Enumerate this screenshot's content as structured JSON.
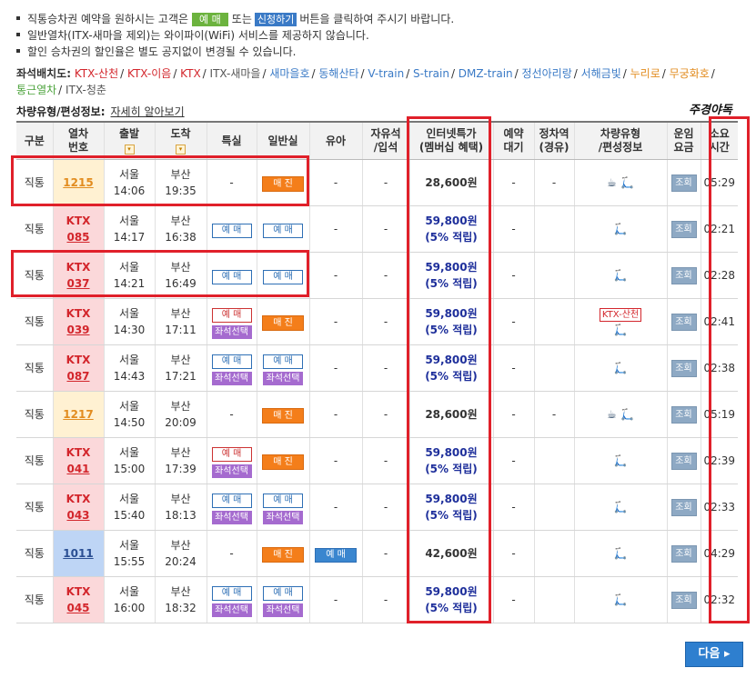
{
  "notes": [
    {
      "pre": "직통승차권 예약을 원하시는 고객은",
      "chip1": "예 매",
      "mid": "또는",
      "chip2": "신청하기",
      "post": "버튼을 클릭하여 주시기 바랍니다."
    },
    {
      "text": "일반열차(ITX-새마을 제외)는 와이파이(WiFi) 서비스를 제공하지 않습니다."
    },
    {
      "text": "할인 승차권의 할인율은 별도 공지없이 변경될 수 있습니다."
    }
  ],
  "seat_layout": {
    "label": "좌석배치도:",
    "types": [
      {
        "name": "KTX-산천",
        "color": "#d3262c"
      },
      {
        "name": "KTX-이음",
        "color": "#d3262c"
      },
      {
        "name": "KTX",
        "color": "#d3262c"
      },
      {
        "name": "ITX-새마을",
        "color": "#555555"
      },
      {
        "name": "새마을호",
        "color": "#3a7ac6"
      },
      {
        "name": "동해산타",
        "color": "#3a7ac6"
      },
      {
        "name": "V-train",
        "color": "#3a7ac6"
      },
      {
        "name": "S-train",
        "color": "#3a7ac6"
      },
      {
        "name": "DMZ-train",
        "color": "#3a7ac6"
      },
      {
        "name": "정선아리랑",
        "color": "#3a7ac6"
      },
      {
        "name": "서해금빛",
        "color": "#3a7ac6"
      },
      {
        "name": "누리로",
        "color": "#e28c1f"
      },
      {
        "name": "무궁화호",
        "color": "#e28c1f"
      },
      {
        "name": "통근열차",
        "color": "#4aa23a"
      },
      {
        "name": "ITX-청춘",
        "color": "#555555"
      }
    ]
  },
  "car_info": {
    "label": "차량유형/편성정보:",
    "link": "자세히 알아보기"
  },
  "weekend_label": "주경야독",
  "headers": {
    "type": "구분",
    "train_no": [
      "열차",
      "번호"
    ],
    "depart": "출발",
    "arrive": "도착",
    "special": "특실",
    "general": "일반실",
    "infant": "유아",
    "standing": [
      "자유석",
      "/입석"
    ],
    "internet": [
      "인터넷특가",
      "(멤버십 혜택)"
    ],
    "reserve": [
      "예약",
      "대기"
    ],
    "stopover": [
      "정차역",
      "(경유)"
    ],
    "car_type": [
      "차량유형",
      "/편성정보"
    ],
    "fare": [
      "운임",
      "요금"
    ],
    "duration": [
      "소요",
      "시간"
    ]
  },
  "rows": [
    {
      "type": "직통",
      "train_kind": "mugung",
      "train_line1": "",
      "train_line2": "1215",
      "dep_station": "서울",
      "dep_time": "14:06",
      "arr_station": "부산",
      "arr_time": "19:35",
      "special": "-",
      "general": "매 진",
      "infant": "-",
      "standing": "-",
      "price": "28,600원",
      "price_sub": "",
      "reserve": "-",
      "stopover": "-",
      "car_tag": "",
      "car_icons": "☕ 🛴",
      "fare": "조회",
      "duration": "05:29"
    },
    {
      "type": "직통",
      "train_kind": "ktx",
      "train_line1": "KTX",
      "train_line2": "085",
      "dep_station": "서울",
      "dep_time": "14:17",
      "arr_station": "부산",
      "arr_time": "16:38",
      "special": "예 매",
      "general": "예 매",
      "infant": "-",
      "standing": "-",
      "price": "59,800원",
      "price_sub": "(5% 적립)",
      "reserve": "-",
      "stopover": "",
      "car_tag": "",
      "car_icons": "🛴",
      "fare": "조회",
      "duration": "02:21"
    },
    {
      "type": "직통",
      "train_kind": "ktx",
      "train_line1": "KTX",
      "train_line2": "037",
      "dep_station": "서울",
      "dep_time": "14:21",
      "arr_station": "부산",
      "arr_time": "16:49",
      "special": "예 매",
      "general": "예 매",
      "infant": "-",
      "standing": "-",
      "price": "59,800원",
      "price_sub": "(5% 적립)",
      "reserve": "-",
      "stopover": "",
      "car_tag": "",
      "car_icons": "🛴",
      "fare": "조회",
      "duration": "02:28"
    },
    {
      "type": "직통",
      "train_kind": "ktx",
      "train_line1": "KTX",
      "train_line2": "039",
      "dep_station": "서울",
      "dep_time": "14:30",
      "arr_station": "부산",
      "arr_time": "17:11",
      "special": "예 매",
      "special_seat": "좌석선택",
      "special_red": true,
      "general": "매 진",
      "infant": "-",
      "standing": "-",
      "price": "59,800원",
      "price_sub": "(5% 적립)",
      "reserve": "-",
      "stopover": "",
      "car_tag": "KTX-산천",
      "car_icons": "🛴",
      "fare": "조회",
      "duration": "02:41"
    },
    {
      "type": "직통",
      "train_kind": "ktx",
      "train_line1": "KTX",
      "train_line2": "087",
      "dep_station": "서울",
      "dep_time": "14:43",
      "arr_station": "부산",
      "arr_time": "17:21",
      "special": "예 매",
      "special_seat": "좌석선택",
      "general": "예 매",
      "general_seat": "좌석선택",
      "infant": "-",
      "standing": "-",
      "price": "59,800원",
      "price_sub": "(5% 적립)",
      "reserve": "-",
      "stopover": "",
      "car_tag": "",
      "car_icons": "🛴",
      "fare": "조회",
      "duration": "02:38"
    },
    {
      "type": "직통",
      "train_kind": "mugung",
      "train_line1": "",
      "train_line2": "1217",
      "dep_station": "서울",
      "dep_time": "14:50",
      "arr_station": "부산",
      "arr_time": "20:09",
      "special": "-",
      "general": "매 진",
      "infant": "-",
      "standing": "-",
      "price": "28,600원",
      "price_sub": "",
      "reserve": "-",
      "stopover": "-",
      "car_tag": "",
      "car_icons": "☕ 🛴",
      "fare": "조회",
      "duration": "05:19"
    },
    {
      "type": "직통",
      "train_kind": "ktx",
      "train_line1": "KTX",
      "train_line2": "041",
      "dep_station": "서울",
      "dep_time": "15:00",
      "arr_station": "부산",
      "arr_time": "17:39",
      "special": "예 매",
      "special_seat": "좌석선택",
      "special_red": true,
      "general": "매 진",
      "infant": "-",
      "standing": "-",
      "price": "59,800원",
      "price_sub": "(5% 적립)",
      "reserve": "-",
      "stopover": "",
      "car_tag": "",
      "car_icons": "🛴",
      "fare": "조회",
      "duration": "02:39"
    },
    {
      "type": "직통",
      "train_kind": "ktx",
      "train_line1": "KTX",
      "train_line2": "043",
      "dep_station": "서울",
      "dep_time": "15:40",
      "arr_station": "부산",
      "arr_time": "18:13",
      "special": "예 매",
      "special_seat": "좌석선택",
      "general": "예 매",
      "general_seat": "좌석선택",
      "infant": "-",
      "standing": "-",
      "price": "59,800원",
      "price_sub": "(5% 적립)",
      "reserve": "-",
      "stopover": "",
      "car_tag": "",
      "car_icons": "🛴",
      "fare": "조회",
      "duration": "02:33"
    },
    {
      "type": "직통",
      "train_kind": "itx",
      "train_line1": "",
      "train_line2": "1011",
      "dep_station": "서울",
      "dep_time": "15:55",
      "arr_station": "부산",
      "arr_time": "20:24",
      "special": "-",
      "general": "매 진",
      "infant": "예 매",
      "standing": "-",
      "price": "42,600원",
      "price_sub": "",
      "reserve": "-",
      "stopover": "",
      "car_tag": "",
      "car_icons": "🛴",
      "fare": "조회",
      "duration": "04:29"
    },
    {
      "type": "직통",
      "train_kind": "ktx",
      "train_line1": "KTX",
      "train_line2": "045",
      "dep_station": "서울",
      "dep_time": "16:00",
      "arr_station": "부산",
      "arr_time": "18:32",
      "special": "예 매",
      "special_seat": "좌석선택",
      "general": "예 매",
      "general_seat": "좌석선택",
      "infant": "-",
      "standing": "-",
      "price": "59,800원",
      "price_sub": "(5% 적립)",
      "reserve": "-",
      "stopover": "",
      "car_tag": "",
      "car_icons": "🛴",
      "fare": "조회",
      "duration": "02:32"
    }
  ],
  "next_button": "다음 ▸"
}
